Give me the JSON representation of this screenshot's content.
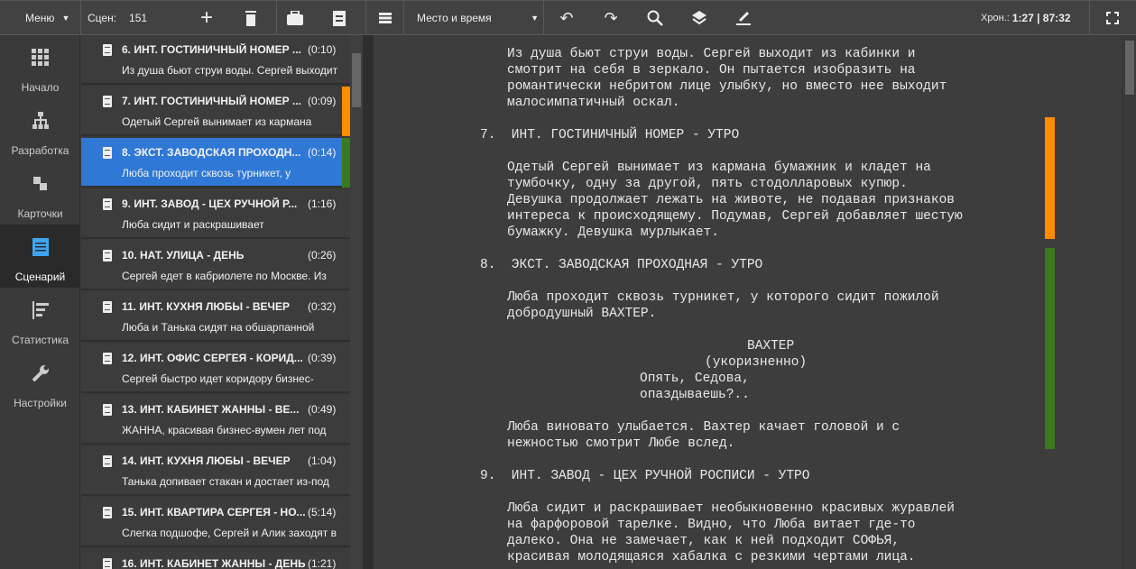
{
  "toolbar": {
    "menu": "Меню",
    "scenes_label": "Сцен:",
    "scenes_count": "151",
    "filter": "Место и время",
    "chron_label": "Хрон.:",
    "chron_value": "1:27 | 87:32"
  },
  "nav": [
    {
      "label": "Начало"
    },
    {
      "label": "Разработка"
    },
    {
      "label": "Карточки"
    },
    {
      "label": "Сценарий"
    },
    {
      "label": "Статистика"
    },
    {
      "label": "Настройки"
    }
  ],
  "scenes": [
    {
      "title": "6. ИНТ. ГОСТИНИЧНЫЙ НОМЕР ...",
      "dur": "(0:10)",
      "desc": "Из душа бьют струи воды. Сергей выходит"
    },
    {
      "title": "7. ИНТ. ГОСТИНИЧНЫЙ НОМЕР ...",
      "dur": "(0:09)",
      "desc": "Одетый Сергей вынимает из кармана",
      "color": "#ff8c00"
    },
    {
      "title": "8. ЭКСТ. ЗАВОДСКАЯ ПРОХОДН...",
      "dur": "(0:14)",
      "desc": "Люба проходит сквозь турникет, у",
      "color": "#3a7a1e"
    },
    {
      "title": "9. ИНТ. ЗАВОД - ЦЕХ РУЧНОЙ Р...",
      "dur": "(1:16)",
      "desc": "Люба сидит и раскрашивает"
    },
    {
      "title": "10. НАТ. УЛИЦА - ДЕНЬ",
      "dur": "(0:26)",
      "desc": "Сергей едет в кабриолете по Москве. Из"
    },
    {
      "title": "11. ИНТ. КУХНЯ ЛЮБЫ - ВЕЧЕР",
      "dur": "(0:32)",
      "desc": "Люба и Танька сидят на обшарпанной"
    },
    {
      "title": "12. ИНТ. ОФИС СЕРГЕЯ - КОРИД...",
      "dur": "(0:39)",
      "desc": "Сергей быстро идет коридору бизнес-"
    },
    {
      "title": "13. ИНТ. КАБИНЕТ ЖАННЫ - ВЕ...",
      "dur": "(0:49)",
      "desc": "ЖАННА, красивая бизнес-вумен лет под"
    },
    {
      "title": "14. ИНТ. КУХНЯ ЛЮБЫ - ВЕЧЕР",
      "dur": "(1:04)",
      "desc": "Танька допивает стакан и достает из-под"
    },
    {
      "title": "15. ИНТ. КВАРТИРА СЕРГЕЯ - НО...",
      "dur": "(5:14)",
      "desc": "Слегка подшофе, Сергей и Алик заходят в"
    },
    {
      "title": "16. ИНТ. КАБИНЕТ ЖАННЫ - ДЕНЬ",
      "dur": "(1:21)",
      "desc": ""
    }
  ],
  "script": {
    "a1": "Из душа бьют струи воды. Сергей выходит из кабинки и\nсмотрит на себя в зеркало. Он пытается изобразить на\nромантически небритом лице улыбку, но вместо нее выходит\nмалосимпатичный оскал.",
    "h7": "7.  ИНТ. ГОСТИНИЧНЫЙ НОМЕР - УТРО",
    "a7": "Одетый Сергей вынимает из кармана бумажник и кладет на\nтумбочку, одну за другой, пять стодолларовых купюр.\nДевушка продолжает лежать на животе, не подавая признаков\nинтереса к происходящему. Подумав, Сергей добавляет шестую\nбумажку. Девушка мурлыкает.",
    "h8": "8.  ЭКСТ. ЗАВОДСКАЯ ПРОХОДНАЯ - УТРО",
    "a8": "Люба проходит сквозь турникет, у которого сидит пожилой\nдобродушный ВАХТЕР.",
    "char": "ВАХТЕР",
    "paren": "(укоризненно)",
    "dial": "Опять, Седова,\nопаздываешь?..",
    "a8b": "Люба виновато улыбается. Вахтер качает головой и с\nнежностью смотрит Любе вслед.",
    "h9": "9.  ИНТ. ЗАВОД - ЦЕХ РУЧНОЙ РОСПИСИ - УТРО",
    "a9": "Люба сидит и раскрашивает необыкновенно красивых журавлей\nна фарфоровой тарелке. Видно, что Люба витает где-то\nдалеко. Она не замечает, как к ней подходит СОФЬЯ,\nкрасивая молодящаяся хабалка с резкими чертами лица."
  },
  "colors": {
    "orange": "#ff8c00",
    "green": "#3a7a1e",
    "selected": "#2f78d6"
  }
}
